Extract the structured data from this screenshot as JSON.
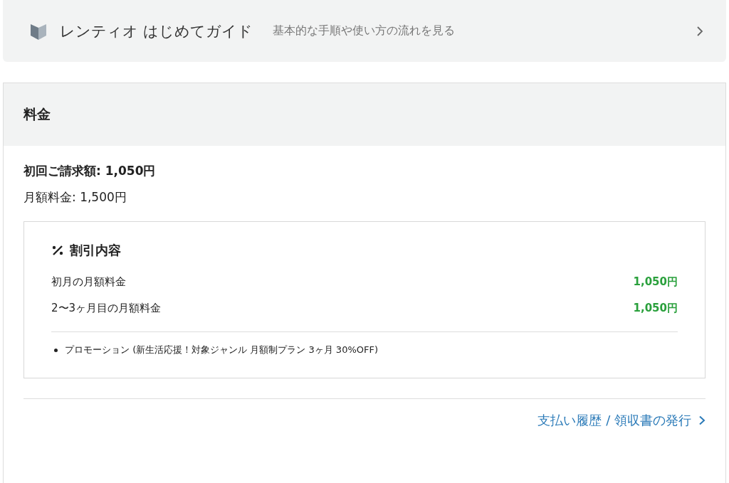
{
  "guide": {
    "title": "レンティオ はじめてガイド",
    "subtitle": "基本的な手順や使い方の流れを見る"
  },
  "pricing": {
    "title": "料金",
    "first_bill": "初回ご請求額: 1,050円",
    "monthly_fee": "月額料金: 1,500円",
    "discount": {
      "title": "割引内容",
      "rows": [
        {
          "label": "初月の月額料金",
          "amount": "1,050円"
        },
        {
          "label": "2〜3ヶ月目の月額料金",
          "amount": "1,050円"
        }
      ],
      "notes": [
        "プロモーション (新生活応援！対象ジャンル 月額制プラン 3ヶ月 30%OFF)"
      ]
    },
    "link": "支払い履歴 / 領収書の発行"
  }
}
